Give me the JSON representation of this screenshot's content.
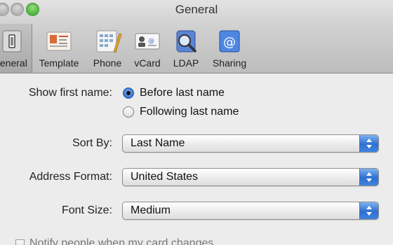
{
  "window": {
    "title": "General"
  },
  "toolbar": {
    "items": [
      {
        "label": "General",
        "icon": "general-icon",
        "selected": true
      },
      {
        "label": "Template",
        "icon": "template-icon",
        "selected": false
      },
      {
        "label": "Phone",
        "icon": "phone-icon",
        "selected": false
      },
      {
        "label": "vCard",
        "icon": "vcard-icon",
        "selected": false
      },
      {
        "label": "LDAP",
        "icon": "ldap-icon",
        "selected": false
      },
      {
        "label": "Sharing",
        "icon": "sharing-icon",
        "selected": false
      }
    ]
  },
  "general": {
    "show_first_name": {
      "label": "Show first name:",
      "options": [
        {
          "label": "Before last name",
          "selected": true
        },
        {
          "label": "Following last name",
          "selected": false
        }
      ]
    },
    "sort_by": {
      "label": "Sort By:",
      "value": "Last Name"
    },
    "address_format": {
      "label": "Address Format:",
      "value": "United States"
    },
    "font_size": {
      "label": "Font Size:",
      "value": "Medium"
    },
    "notify": {
      "label": "Notify people when my card changes",
      "checked": false
    }
  },
  "colors": {
    "accent": "#3a79d4",
    "window_bg": "#ececec",
    "traffic_max": "#2f9b1e"
  }
}
